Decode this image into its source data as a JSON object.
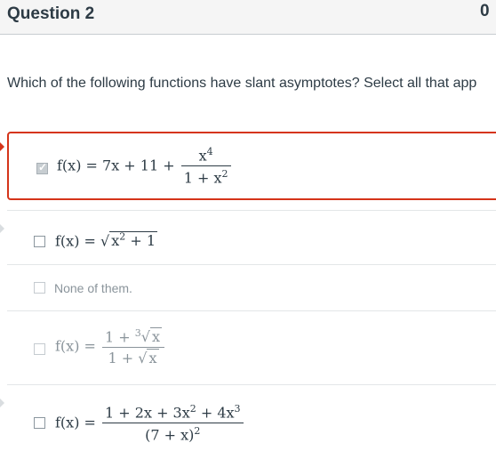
{
  "header": {
    "title": "Question 2",
    "points": "0"
  },
  "prompt": "Which of the following functions have slant asymptotes? Select all that app",
  "answers": [
    {
      "selected": true,
      "lhs": "f(x) = 7x + 11 +",
      "num": "x",
      "num_sup": "4",
      "den": "1 + x",
      "den_sup": "2"
    },
    {
      "selected": false,
      "lhs": "f(x) = ",
      "rad": "x",
      "rad_sup": "2",
      "rad_tail": " + 1"
    },
    {
      "selected": false,
      "text": "None of them."
    },
    {
      "selected": false,
      "lhs": "f(x) =",
      "num": "1 + ",
      "num_root_index": "3",
      "num_rad": "x",
      "den": "1 + ",
      "den_rad": "x"
    },
    {
      "selected": false,
      "lhs": "f(x) =",
      "num": "1 + 2x + 3x",
      "num_sup1": "2",
      "num_mid": " + 4x",
      "num_sup2": "3",
      "den": "(7 + x)",
      "den_sup": "2"
    }
  ]
}
